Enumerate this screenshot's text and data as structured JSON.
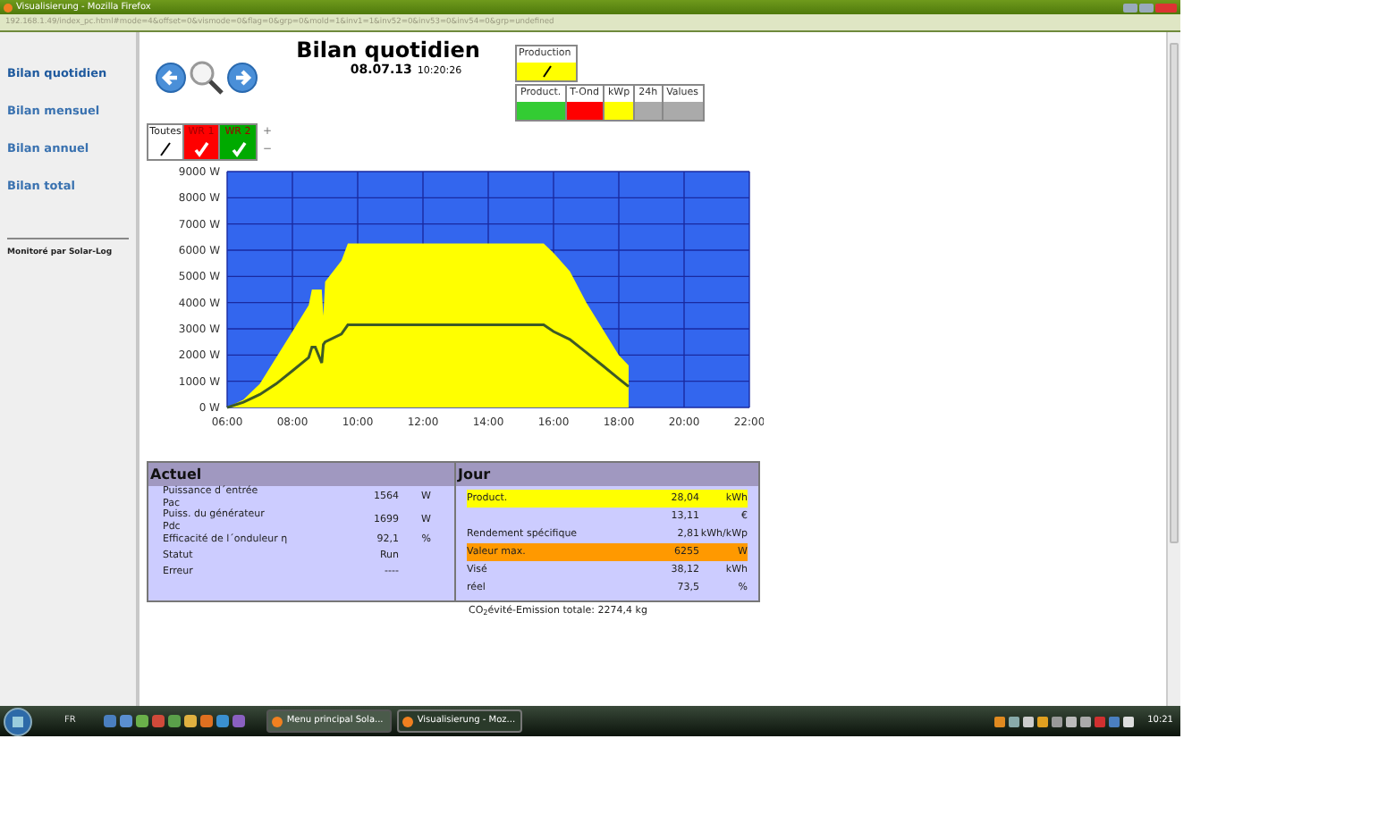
{
  "window": {
    "title": "Visualisierung - Mozilla Firefox"
  },
  "address_bar": {
    "url": "192.168.1.49/index_pc.html#mode=4&offset=0&vismode=0&flag=0&grp=0&mold=1&inv1=1&inv52=0&inv53=0&inv54=0&grp=undefined"
  },
  "sidebar": {
    "items": [
      {
        "label": "Bilan quotidien",
        "selected": true
      },
      {
        "label": "Bilan mensuel",
        "selected": false
      },
      {
        "label": "Bilan annuel",
        "selected": false
      },
      {
        "label": "Bilan total",
        "selected": false
      }
    ],
    "footer": "Monitoré par Solar-Log"
  },
  "header": {
    "title": "Bilan quotidien",
    "date": "08.07.13",
    "time": "10:20:26"
  },
  "production": {
    "label": "Production"
  },
  "modes": [
    {
      "label": "Product.",
      "color": "#33cc33"
    },
    {
      "label": "T-Ond",
      "color": "#ff0000"
    },
    {
      "label": "kWp",
      "color": "#ffff00"
    },
    {
      "label": "24h",
      "color": "#aaaaaa"
    },
    {
      "label": "Values",
      "color": "#aaaaaa"
    }
  ],
  "legend": [
    {
      "label": "Toutes",
      "kind": "all",
      "color": "#ffffff"
    },
    {
      "label": "WR 1",
      "kind": "series",
      "color": "#ff0000"
    },
    {
      "label": "WR 2",
      "kind": "series",
      "color": "#00aa00"
    }
  ],
  "legend_buttons": [
    "+",
    "−"
  ],
  "chart": {
    "chart_data": {
      "type": "area",
      "x": [
        6,
        6.5,
        7,
        7.5,
        8,
        8.5,
        8.6,
        8.7,
        8.9,
        8.95,
        9,
        9.5,
        9.7,
        10,
        12,
        14,
        15.7,
        16,
        16.5,
        17,
        17.5,
        18,
        18.3
      ],
      "series": [
        {
          "type": "area",
          "color": "#ffff00",
          "values": [
            0,
            300,
            900,
            1900,
            2900,
            3900,
            4500,
            4500,
            4500,
            3500,
            4800,
            5600,
            6250,
            6250,
            6250,
            6250,
            6250,
            5900,
            5200,
            4000,
            3000,
            2000,
            1600
          ]
        },
        {
          "type": "line",
          "color": "#3d5a26",
          "values": [
            0,
            200,
            500,
            900,
            1400,
            1900,
            2300,
            2300,
            1700,
            2400,
            2500,
            2800,
            3150,
            3150,
            3150,
            3150,
            3150,
            2900,
            2600,
            2100,
            1600,
            1100,
            800
          ]
        }
      ],
      "grid": true,
      "xlim": [
        6,
        22
      ],
      "ylim": [
        0,
        9000
      ],
      "xticks": [
        {
          "value": 6,
          "label": "06:00"
        },
        {
          "value": 8,
          "label": "08:00"
        },
        {
          "value": 10,
          "label": "10:00"
        },
        {
          "value": 12,
          "label": "12:00"
        },
        {
          "value": 14,
          "label": "14:00"
        },
        {
          "value": 16,
          "label": "16:00"
        },
        {
          "value": 18,
          "label": "18:00"
        },
        {
          "value": 20,
          "label": "20:00"
        },
        {
          "value": 22,
          "label": "22:00"
        }
      ],
      "yticks": [
        {
          "value": 0,
          "label": "0 W"
        },
        {
          "value": 1000,
          "label": "1000 W"
        },
        {
          "value": 2000,
          "label": "2000 W"
        },
        {
          "value": 3000,
          "label": "3000 W"
        },
        {
          "value": 4000,
          "label": "4000 W"
        },
        {
          "value": 5000,
          "label": "5000 W"
        },
        {
          "value": 6000,
          "label": "6000 W"
        },
        {
          "value": 7000,
          "label": "7000 W"
        },
        {
          "value": 8000,
          "label": "8000 W"
        },
        {
          "value": 9000,
          "label": "9000 W"
        }
      ]
    }
  },
  "actuel": {
    "title": "Actuel",
    "rows": [
      {
        "label": "Puissance d´entrée",
        "sub": "Pac",
        "value": "1564",
        "unit": "W"
      },
      {
        "label": "Puiss. du générateur",
        "sub": "Pdc",
        "value": "1699",
        "unit": "W"
      },
      {
        "label": "Efficacité de l´onduleur η",
        "value": "92,1",
        "unit": "%"
      },
      {
        "label": "Statut",
        "value": "Run"
      },
      {
        "label": "Erreur",
        "value": "----"
      }
    ]
  },
  "jour": {
    "title": "Jour",
    "rows": [
      {
        "label": "Product.",
        "value": "28,04",
        "unit": "kWh",
        "color": "#ffff00"
      },
      {
        "value": "13,11",
        "unit": "€"
      },
      {
        "label": "Rendement spécifique",
        "value": "2,81",
        "unit": "kWh/kWp"
      },
      {
        "label": "Valeur max.",
        "value": "6255",
        "unit": "W",
        "color": "#ff9900"
      },
      {
        "label": "Visé",
        "value": "38,12",
        "unit": "kWh"
      },
      {
        "label": "réel",
        "value": "73,5",
        "unit": "%"
      }
    ]
  },
  "co2": "CO$_{2}$évité-Emission totale: 2274,4 kg",
  "taskbar": {
    "language": "FR",
    "tasks": [
      {
        "label": "Menu principal Sola...",
        "selected": false
      },
      {
        "label": "Visualisierung - Moz...",
        "selected": true
      }
    ],
    "clock": "10:21"
  }
}
